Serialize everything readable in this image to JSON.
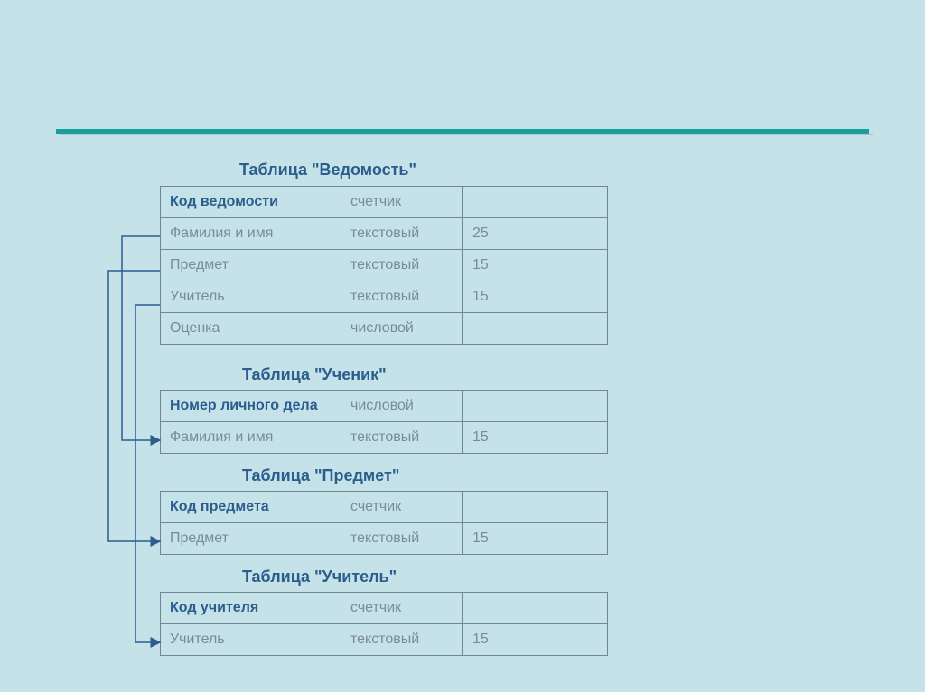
{
  "tables": [
    {
      "title": "Таблица \"Ведомость\"",
      "rows": [
        {
          "name": "Код ведомости",
          "type": "счетчик",
          "size": "",
          "key": true
        },
        {
          "name": "Фамилия и имя",
          "type": "текстовый",
          "size": "25",
          "key": false
        },
        {
          "name": "Предмет",
          "type": "текстовый",
          "size": "15",
          "key": false
        },
        {
          "name": "Учитель",
          "type": "текстовый",
          "size": "15",
          "key": false
        },
        {
          "name": "Оценка",
          "type": "числовой",
          "size": "",
          "key": false
        }
      ]
    },
    {
      "title": "Таблица \"Ученик\"",
      "rows": [
        {
          "name": "Номер личного дела",
          "type": "числовой",
          "size": "",
          "key": true
        },
        {
          "name": "Фамилия и имя",
          "type": "текстовый",
          "size": "15",
          "key": false
        }
      ]
    },
    {
      "title": "Таблица \"Предмет\"",
      "rows": [
        {
          "name": "Код предмета",
          "type": "счетчик",
          "size": "",
          "key": true
        },
        {
          "name": "Предмет",
          "type": "текстовый",
          "size": "15",
          "key": false
        }
      ]
    },
    {
      "title": "Таблица \"Учитель\"",
      "rows": [
        {
          "name": "Код учителя",
          "type": "счетчик",
          "size": "",
          "key": true
        },
        {
          "name": "Учитель",
          "type": "текстовый",
          "size": "15",
          "key": false
        }
      ]
    }
  ]
}
